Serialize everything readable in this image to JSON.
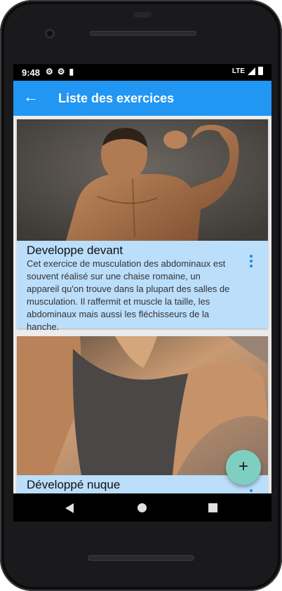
{
  "status_bar": {
    "time": "9:48",
    "network": "LTE"
  },
  "app_bar": {
    "back_icon": "arrow-left-icon",
    "title": "Liste des exercices"
  },
  "cards": [
    {
      "title": "Developpe devant",
      "description": "Cet exercice de musculation des abdominaux est souvent réalisé sur une chaise romaine, un appareil qu'on trouve dans la plupart des salles de musculation. Il raffermit et muscle la taille, les abdominaux mais aussi les fléchisseurs de la hanche.",
      "image": "muscular-back-photo",
      "menu_icon": "more-vert-icon"
    },
    {
      "title": "Développé nuque",
      "description": "",
      "image": "shoulder-tank-top-photo",
      "menu_icon": "more-vert-icon"
    }
  ],
  "fab": {
    "label": "+",
    "color": "#7fcfc1"
  },
  "colors": {
    "app_bar": "#2196f3",
    "card": "#bbdefb",
    "accent": "#1e88e5"
  }
}
